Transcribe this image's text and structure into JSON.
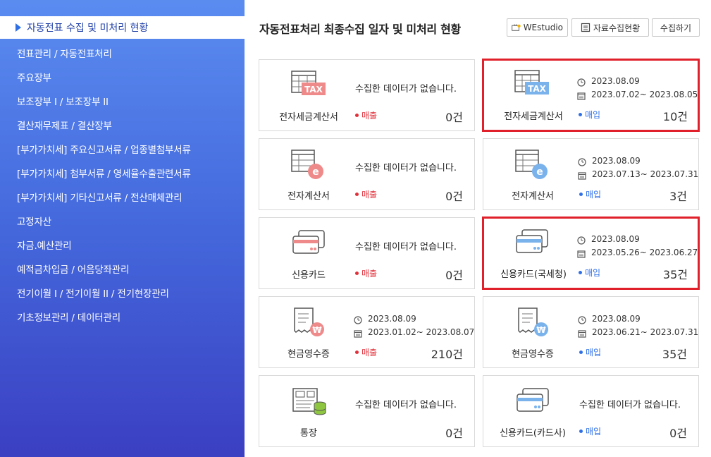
{
  "sidebar": {
    "active": "자동전표 수집 및 미처리 현황",
    "items": [
      "전표관리 / 자동전표처리",
      "주요장부",
      "보조장부 I / 보조장부 II",
      "결산재무제표 / 결산장부",
      "[부가가치세] 주요신고서류 / 업종별첨부서류",
      "[부가가치세] 첨부서류 / 영세율수출관련서류",
      "[부가가치세] 기타신고서류 / 전산매체관리",
      "고정자산",
      "자금.예산관리",
      "예적금차입금 / 어음당좌관리",
      "전기이월 I / 전기이월 II / 전기현장관리",
      "기초정보관리 / 데이터관리"
    ]
  },
  "header": {
    "title": "자동전표처리 최종수집 일자 및 미처리 현황",
    "btn_westudio": "WEstudio",
    "btn_status": "자료수집현황",
    "btn_collect": "수집하기"
  },
  "colors": {
    "sell": "#e0303a",
    "buy": "#2f6fe6",
    "highlight": "#e0202a"
  },
  "cards": [
    {
      "name": "전자세금계산서",
      "icon": "tax-invoice-red-icon",
      "nodata": "수집한 데이터가 없습니다.",
      "tag": "매출",
      "count": "0건"
    },
    {
      "name": "전자세금계산서",
      "icon": "tax-invoice-blue-icon",
      "date": "2023.08.09",
      "range": "2023.07.02~ 2023.08.05",
      "tag": "매입",
      "count": "10건"
    },
    {
      "name": "전자계산서",
      "icon": "e-invoice-red-icon",
      "nodata": "수집한 데이터가 없습니다.",
      "tag": "매출",
      "count": "0건"
    },
    {
      "name": "전자계산서",
      "icon": "e-invoice-blue-icon",
      "date": "2023.08.09",
      "range": "2023.07.13~ 2023.07.31",
      "tag": "매입",
      "count": "3건"
    },
    {
      "name": "신용카드",
      "icon": "credit-card-red-icon",
      "nodata": "수집한 데이터가 없습니다.",
      "tag": "매출",
      "count": "0건"
    },
    {
      "name": "신용카드(국세청)",
      "icon": "credit-card-blue-icon",
      "date": "2023.08.09",
      "range": "2023.05.26~ 2023.06.27",
      "tag": "매입",
      "count": "35건"
    },
    {
      "name": "현금영수증",
      "icon": "cash-receipt-red-icon",
      "date": "2023.08.09",
      "range": "2023.01.02~ 2023.08.07",
      "tag": "매출",
      "count": "210건"
    },
    {
      "name": "현금영수증",
      "icon": "cash-receipt-blue-icon",
      "date": "2023.08.09",
      "range": "2023.06.21~ 2023.07.31",
      "tag": "매입",
      "count": "35건"
    },
    {
      "name": "통장",
      "icon": "bankbook-icon",
      "nodata": "수집한 데이터가 없습니다.",
      "count": "0건"
    },
    {
      "name": "신용카드(카드사)",
      "icon": "credit-card-blue-icon",
      "nodata": "수집한 데이터가 없습니다.",
      "tag": "매입",
      "count": "0건"
    }
  ]
}
